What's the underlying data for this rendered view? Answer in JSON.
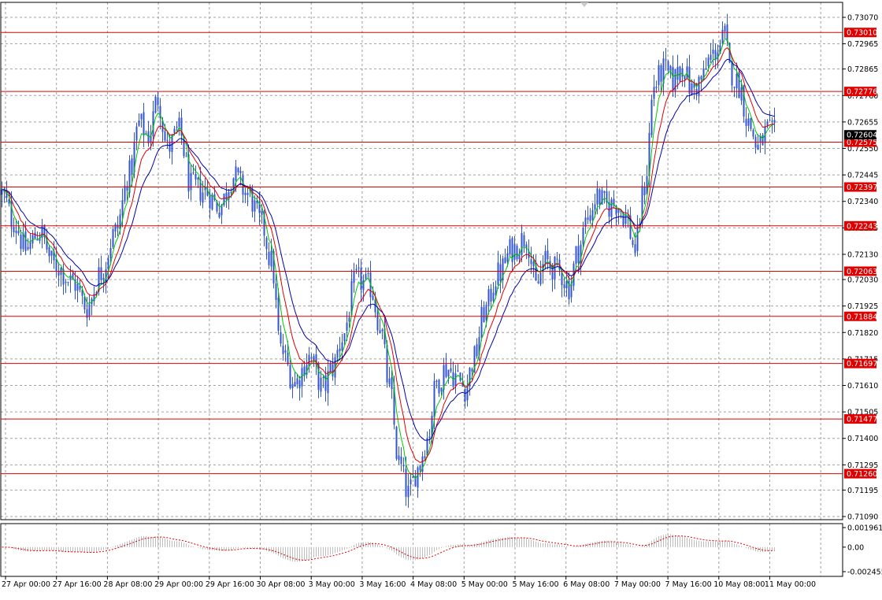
{
  "chart_data": [
    {
      "type": "candlestick",
      "panel": "main",
      "y_axis": {
        "ticks": [
          "0.73070",
          "0.72965",
          "0.72865",
          "0.72760",
          "0.72655",
          "0.72550",
          "0.72445",
          "0.72340",
          "0.72235",
          "0.72130",
          "0.72030",
          "0.71925",
          "0.71820",
          "0.71715",
          "0.71610",
          "0.71505",
          "0.71400",
          "0.71295",
          "0.71195",
          "0.71090"
        ],
        "ylim": [
          0.7109,
          0.7307
        ]
      },
      "x_axis": {
        "labels": [
          "27 Apr 00:00",
          "27 Apr 16:00",
          "28 Apr 08:00",
          "29 Apr 00:00",
          "29 Apr 16:00",
          "30 Apr 08:00",
          "3 May 00:00",
          "3 May 16:00",
          "4 May 08:00",
          "5 May 00:00",
          "5 May 16:00",
          "6 May 08:00",
          "7 May 00:00",
          "7 May 16:00",
          "10 May 08:00",
          "11 May 00:00"
        ]
      },
      "horizontal_levels": [
        "0.73010",
        "0.72776",
        "0.72575",
        "0.72397",
        "0.72243",
        "0.72063",
        "0.71884",
        "0.71697",
        "0.71477",
        "0.71260"
      ],
      "current_price": "0.72604",
      "key_points": [
        {
          "bar": 0,
          "price": 0.7237
        },
        {
          "bar": 5,
          "price": 0.7226
        },
        {
          "bar": 10,
          "price": 0.7215
        },
        {
          "bar": 16,
          "price": 0.7222
        },
        {
          "bar": 22,
          "price": 0.7209
        },
        {
          "bar": 30,
          "price": 0.7202
        },
        {
          "bar": 36,
          "price": 0.7192
        },
        {
          "bar": 42,
          "price": 0.7206
        },
        {
          "bar": 48,
          "price": 0.7222
        },
        {
          "bar": 54,
          "price": 0.7245
        },
        {
          "bar": 58,
          "price": 0.7265
        },
        {
          "bar": 62,
          "price": 0.726
        },
        {
          "bar": 66,
          "price": 0.7275
        },
        {
          "bar": 70,
          "price": 0.7255
        },
        {
          "bar": 75,
          "price": 0.7262
        },
        {
          "bar": 80,
          "price": 0.724
        },
        {
          "bar": 86,
          "price": 0.7238
        },
        {
          "bar": 92,
          "price": 0.7232
        },
        {
          "bar": 98,
          "price": 0.7244
        },
        {
          "bar": 104,
          "price": 0.7237
        },
        {
          "bar": 110,
          "price": 0.7225
        },
        {
          "bar": 114,
          "price": 0.721
        },
        {
          "bar": 118,
          "price": 0.7175
        },
        {
          "bar": 124,
          "price": 0.7162
        },
        {
          "bar": 130,
          "price": 0.7172
        },
        {
          "bar": 136,
          "price": 0.716
        },
        {
          "bar": 140,
          "price": 0.7168
        },
        {
          "bar": 144,
          "price": 0.718
        },
        {
          "bar": 150,
          "price": 0.7203
        },
        {
          "bar": 156,
          "price": 0.72
        },
        {
          "bar": 160,
          "price": 0.7185
        },
        {
          "bar": 164,
          "price": 0.716
        },
        {
          "bar": 168,
          "price": 0.713
        },
        {
          "bar": 172,
          "price": 0.7118
        },
        {
          "bar": 176,
          "price": 0.7128
        },
        {
          "bar": 180,
          "price": 0.714
        },
        {
          "bar": 184,
          "price": 0.7162
        },
        {
          "bar": 188,
          "price": 0.7168
        },
        {
          "bar": 192,
          "price": 0.7165
        },
        {
          "bar": 196,
          "price": 0.716
        },
        {
          "bar": 200,
          "price": 0.7172
        },
        {
          "bar": 204,
          "price": 0.719
        },
        {
          "bar": 210,
          "price": 0.7205
        },
        {
          "bar": 216,
          "price": 0.7215
        },
        {
          "bar": 222,
          "price": 0.722
        },
        {
          "bar": 226,
          "price": 0.72
        },
        {
          "bar": 230,
          "price": 0.721
        },
        {
          "bar": 236,
          "price": 0.7206
        },
        {
          "bar": 240,
          "price": 0.72
        },
        {
          "bar": 244,
          "price": 0.7215
        },
        {
          "bar": 248,
          "price": 0.7228
        },
        {
          "bar": 252,
          "price": 0.7236
        },
        {
          "bar": 256,
          "price": 0.7232
        },
        {
          "bar": 260,
          "price": 0.7233
        },
        {
          "bar": 264,
          "price": 0.7228
        },
        {
          "bar": 268,
          "price": 0.7215
        },
        {
          "bar": 272,
          "price": 0.724
        },
        {
          "bar": 276,
          "price": 0.728
        },
        {
          "bar": 280,
          "price": 0.7286
        },
        {
          "bar": 284,
          "price": 0.7282
        },
        {
          "bar": 288,
          "price": 0.7288
        },
        {
          "bar": 292,
          "price": 0.7278
        },
        {
          "bar": 296,
          "price": 0.7282
        },
        {
          "bar": 300,
          "price": 0.7291
        },
        {
          "bar": 304,
          "price": 0.7296
        },
        {
          "bar": 306,
          "price": 0.73
        },
        {
          "bar": 308,
          "price": 0.7286
        },
        {
          "bar": 312,
          "price": 0.728
        },
        {
          "bar": 316,
          "price": 0.7265
        },
        {
          "bar": 320,
          "price": 0.7255
        },
        {
          "bar": 324,
          "price": 0.7262
        },
        {
          "bar": 327,
          "price": 0.726
        }
      ],
      "moving_averages": [
        {
          "color": "#00c800",
          "period": 5
        },
        {
          "color": "#e00000",
          "period": 10
        },
        {
          "color": "#0000aa",
          "period": 18
        }
      ]
    },
    {
      "type": "histogram",
      "panel": "oscillator",
      "y_axis": {
        "ticks": [
          "0.001961",
          "0.00",
          "-0.002455"
        ],
        "ylim": [
          -0.002455,
          0.001961
        ]
      }
    }
  ],
  "colors": {
    "candle": "#3355cc",
    "level_line": "#e00000",
    "level_tag": "#e00000",
    "current_tag": "#000000",
    "grid": "#a0a0a0",
    "frame": "#000000",
    "osc_hist": "#bdbdbd",
    "osc_signal": "#e00000"
  }
}
